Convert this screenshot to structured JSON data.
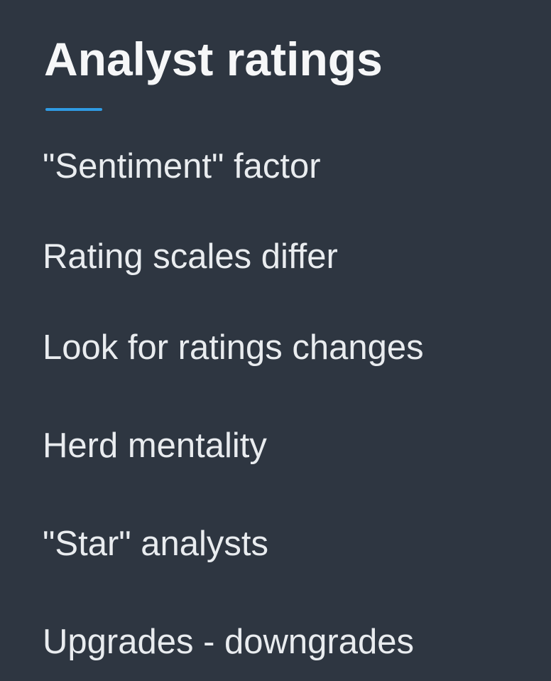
{
  "slide": {
    "title": "Analyst ratings",
    "accent_color": "#2f9be3",
    "background_color": "#2e3641",
    "bullets": [
      {
        "text": "\"Sentiment\" factor"
      },
      {
        "text": "Rating scales differ"
      },
      {
        "text": "Look for ratings changes"
      },
      {
        "text": "Herd mentality"
      },
      {
        "text": "\"Star\" analysts"
      },
      {
        "text": "Upgrades - downgrades"
      }
    ]
  }
}
